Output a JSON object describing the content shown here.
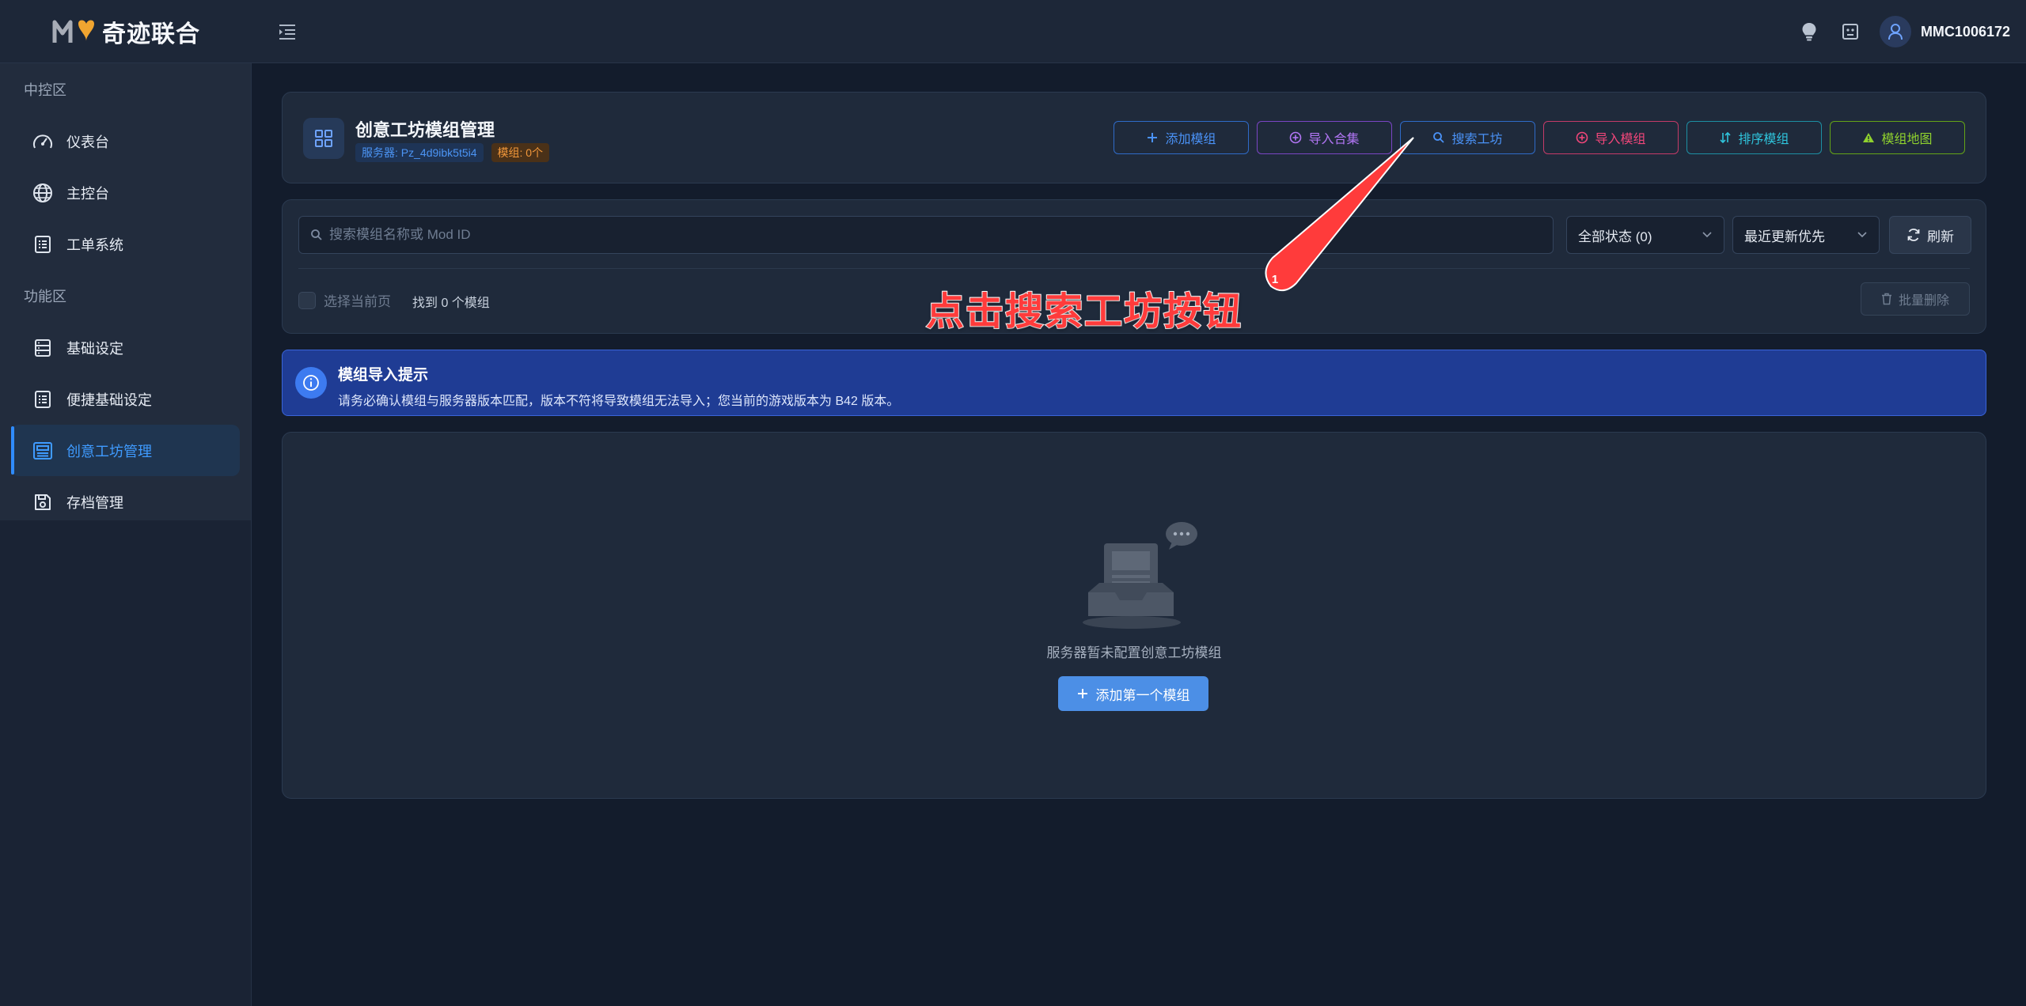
{
  "app": {
    "logo_text": "奇迹联合",
    "logo_mark": "M"
  },
  "topbar": {
    "username": "MMC1006172",
    "icons": [
      "menu-toggle-icon",
      "lightbulb-icon",
      "robot-face-icon",
      "user-icon"
    ]
  },
  "sidebar": {
    "sections": [
      {
        "label": "中控区",
        "items": [
          {
            "label": "仪表台",
            "icon": "speedometer-icon"
          },
          {
            "label": "主控台",
            "icon": "globe-icon"
          },
          {
            "label": "工单系统",
            "icon": "list-document-icon"
          }
        ]
      },
      {
        "label": "功能区",
        "items": [
          {
            "label": "基础设定",
            "icon": "server-stack-icon"
          },
          {
            "label": "便捷基础设定",
            "icon": "list-document-icon"
          },
          {
            "label": "创意工坊管理",
            "icon": "workshop-icon",
            "active": true
          },
          {
            "label": "存档管理",
            "icon": "save-disk-icon"
          }
        ]
      }
    ]
  },
  "header": {
    "title": "创意工坊模组管理",
    "server_tag": "服务器: Pz_4d9ibk5t5i4",
    "mods_tag": "模组: 0个",
    "actions": [
      {
        "label": "添加模组",
        "icon": "plus-icon",
        "color": "#3b82f6"
      },
      {
        "label": "导入合集",
        "icon": "plus-circle-icon",
        "color": "#a855f7"
      },
      {
        "label": "搜索工坊",
        "icon": "search-icon",
        "color": "#3b82f6"
      },
      {
        "label": "导入模组",
        "icon": "plus-circle-icon",
        "color": "#f0467a"
      },
      {
        "label": "排序模组",
        "icon": "sort-icon",
        "color": "#22b8cf"
      },
      {
        "label": "模组地图",
        "icon": "triangle-map-icon",
        "color": "#84cc16"
      }
    ]
  },
  "filters": {
    "search_placeholder": "搜索模组名称或 Mod ID",
    "status_select": "全部状态 (0)",
    "sort_select": "最近更新优先",
    "refresh_label": "刷新",
    "select_page_label": "选择当前页",
    "found_text": "找到 0 个模组",
    "bulk_delete_label": "批量删除"
  },
  "notice": {
    "title": "模组导入提示",
    "text": "请务必确认模组与服务器版本匹配，版本不符将导致模组无法导入；您当前的游戏版本为 B42 版本。"
  },
  "empty_state": {
    "text": "服务器暂未配置创意工坊模组",
    "button_label": "添加第一个模组"
  },
  "annotation": {
    "badge": "1",
    "text": "点击搜索工坊按钮",
    "color": "#ff3b3b"
  },
  "colors": {
    "accent": "#2f8cff",
    "background": "#131c2c",
    "card": "#1f2a3b",
    "notice": "#1f3c94"
  }
}
